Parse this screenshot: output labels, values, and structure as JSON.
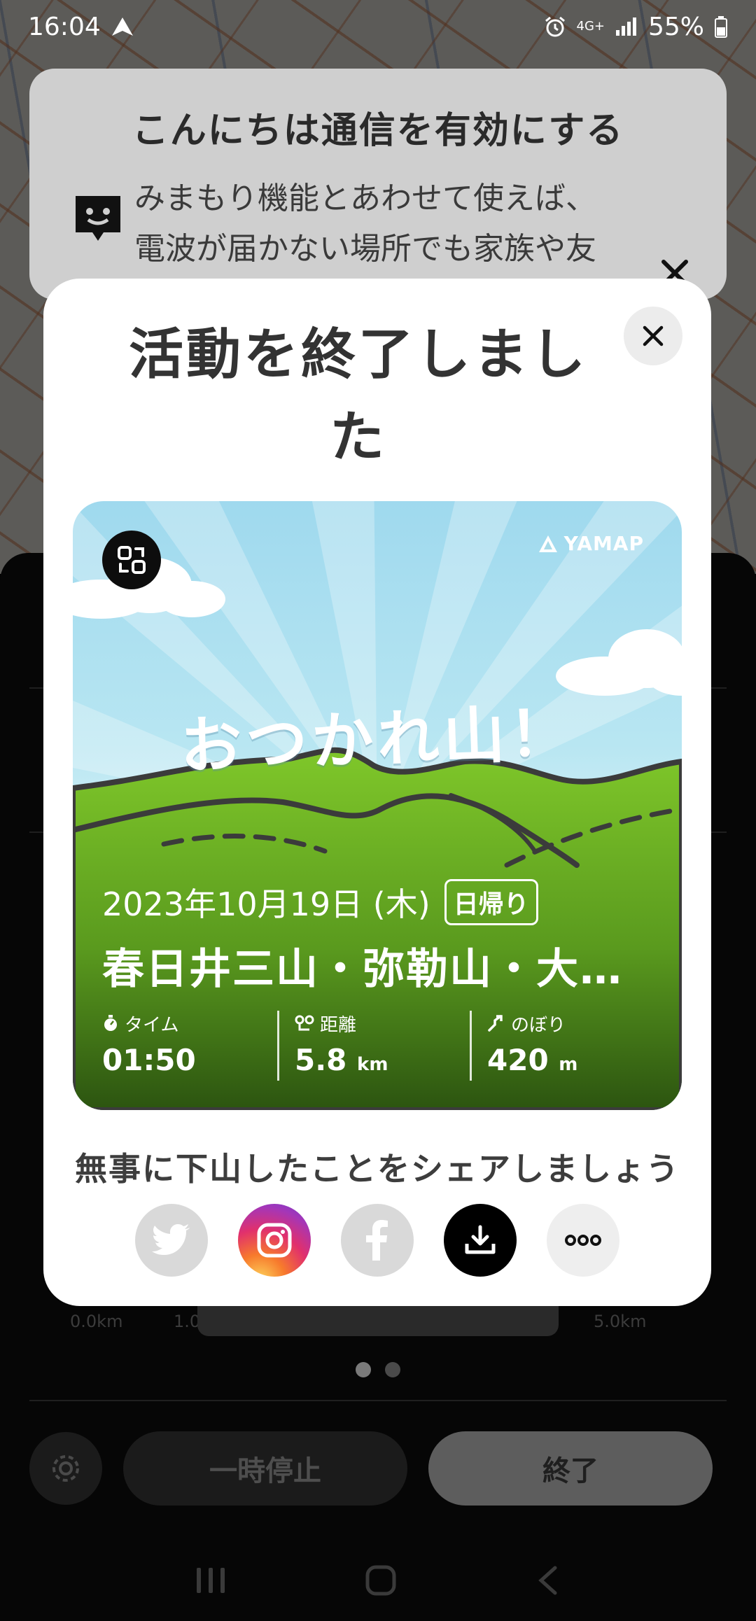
{
  "status_bar": {
    "time": "16:04",
    "network": "4G+",
    "battery": "55%"
  },
  "notification": {
    "title": "こんにちは通信を有効にする",
    "body_line1": "みまもり機能とあわせて使えば、",
    "body_line2": "電波が届かない場所でも家族や友"
  },
  "panel": {
    "x_labels": [
      "0.0km",
      "1.0",
      "5.0km"
    ],
    "pause_label": "一時停止",
    "end_label": "終了"
  },
  "modal": {
    "title": "活動を終了しました",
    "card": {
      "brand": "YAMAP",
      "headline": "おつかれ山！",
      "date": "2023年10月19日 (木)",
      "trip_type": "日帰り",
      "route": "春日井三山・弥勒山・大…",
      "stats": [
        {
          "label": "タイム",
          "value": "01:50",
          "unit": ""
        },
        {
          "label": "距離",
          "value": "5.8",
          "unit": "km"
        },
        {
          "label": "のぼり",
          "value": "420",
          "unit": "m"
        }
      ]
    },
    "share_prompt": "無事に下山したことをシェアしましょう"
  }
}
